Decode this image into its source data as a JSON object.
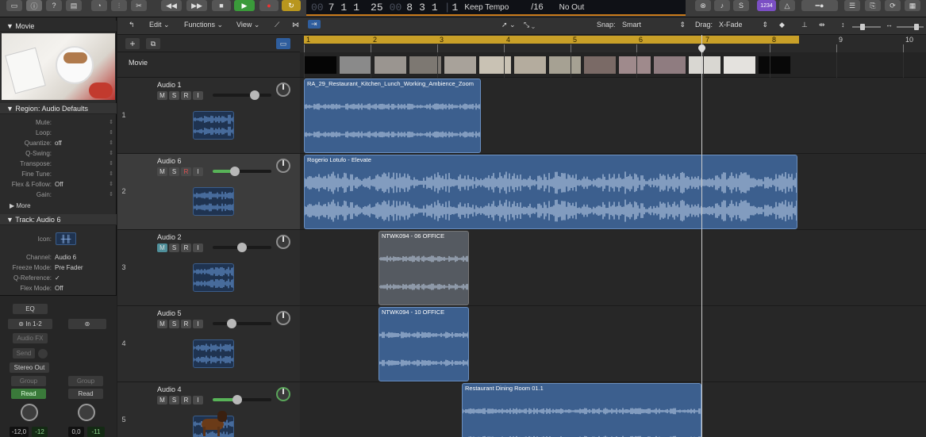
{
  "transport": {
    "pos_bar": "7",
    "pos_beat": "1",
    "pos_div": "1",
    "pos_tick": "25",
    "time_bar": "8",
    "time_beat": "3",
    "time_div": "1",
    "time_tick": "1",
    "pos_prefix": "00",
    "time_prefix": "00",
    "tempo": "Keep Tempo",
    "signature": "/16",
    "output": "No Out",
    "counter_label": "1234"
  },
  "inspector": {
    "movie_header": "Movie",
    "region_header": "Region: Audio Defaults",
    "region_rows": [
      {
        "label": "Mute:",
        "value": ""
      },
      {
        "label": "Loop:",
        "value": ""
      },
      {
        "label": "Quantize:",
        "value": "off"
      },
      {
        "label": "Q-Swing:",
        "value": ""
      },
      {
        "label": "Transpose:",
        "value": ""
      },
      {
        "label": "Fine Tune:",
        "value": ""
      },
      {
        "label": "Flex & Follow:",
        "value": "Off"
      },
      {
        "label": "Gain:",
        "value": ""
      }
    ],
    "more": "More",
    "track_header": "Track:  Audio 6",
    "track_rows": [
      {
        "label": "Icon:",
        "value": ""
      },
      {
        "label": "Channel:",
        "value": "Audio 6"
      },
      {
        "label": "Freeze Mode:",
        "value": "Pre Fader"
      },
      {
        "label": "Q-Reference:",
        "value": "✓"
      },
      {
        "label": "Flex Mode:",
        "value": "Off"
      }
    ],
    "strip": {
      "eq": "EQ",
      "input": "In 1-2",
      "audio_fx": "Audio FX",
      "send": "Send",
      "output": "Stereo Out",
      "group_left": "Group",
      "group_right": "Group",
      "read_left": "Read",
      "read_right": "Read",
      "vol_left": "-12,0",
      "peak_left": "-12",
      "vol_right": "0,0",
      "peak_right": "-11"
    }
  },
  "toolbar": {
    "edit": "Edit",
    "functions": "Functions",
    "view": "View",
    "snap_label": "Snap:",
    "snap_value": "Smart",
    "drag_label": "Drag:",
    "drag_value": "X-Fade"
  },
  "ruler": {
    "bars": [
      "1",
      "2",
      "3",
      "4",
      "5",
      "6",
      "7",
      "8",
      "9",
      "10"
    ]
  },
  "movie_track": {
    "name": "Movie"
  },
  "tracks": [
    {
      "number": "1",
      "name": "Audio 1",
      "fader": 0.72
    },
    {
      "number": "2",
      "name": "Audio 6",
      "fader": 0.38
    },
    {
      "number": "3",
      "name": "Audio 2",
      "fader": 0.5
    },
    {
      "number": "4",
      "name": "Audio 5",
      "fader": 0.32
    },
    {
      "number": "5",
      "name": "Audio 4",
      "fader": 0.42
    }
  ],
  "msri": {
    "m": "M",
    "s": "S",
    "r": "R",
    "i": "I"
  },
  "regions": [
    {
      "name": "RA_29_Restaurant_Kitchen_Lunch_Working_Ambience_Zoom"
    },
    {
      "name": "Rogerio Lotufo - Elevate"
    },
    {
      "name": "NTWK094 - 06    OFFICE"
    },
    {
      "name": "NTWK094 - 10    OFFICE"
    },
    {
      "name": "Restaurant Dining Room 01.1"
    }
  ],
  "colors": {
    "region": "#3c5f8e",
    "cycle": "#c9a028",
    "play": "#3a9a3a"
  }
}
